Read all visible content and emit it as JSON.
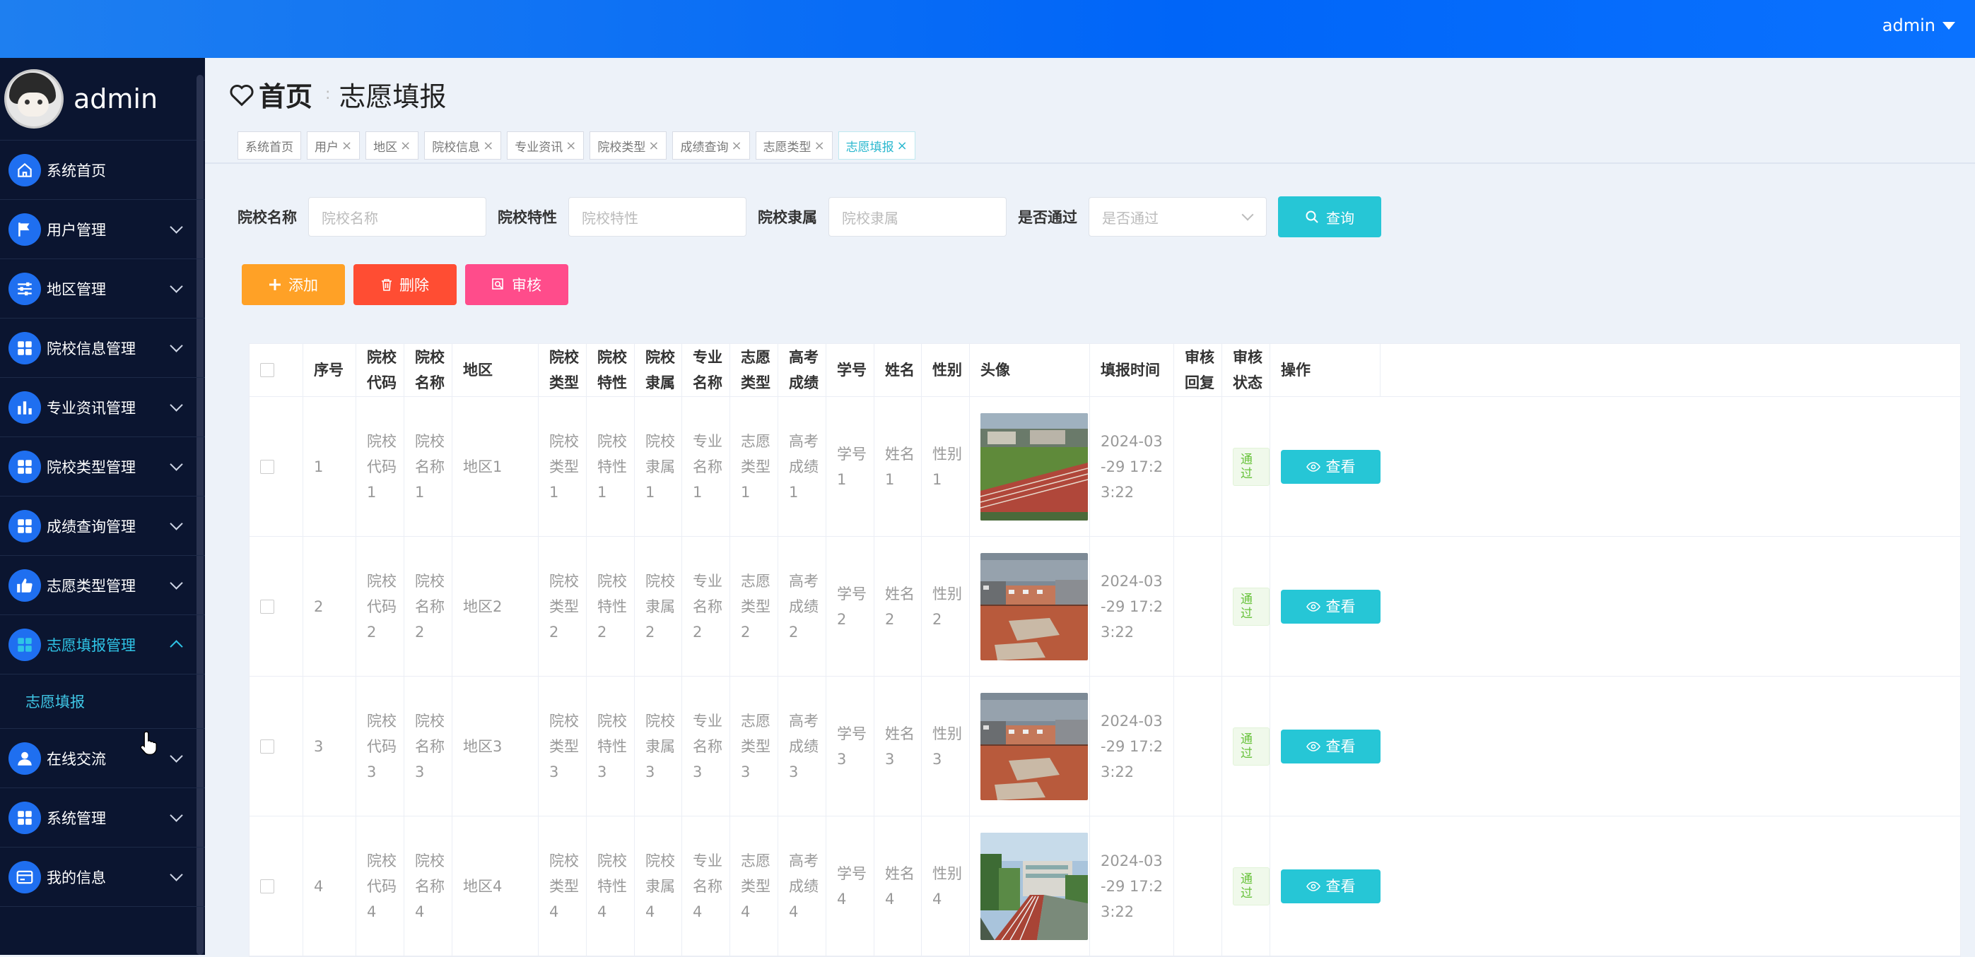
{
  "header": {
    "user": "admin"
  },
  "sidebar": {
    "brand_name": "admin",
    "items": [
      {
        "label": "系统首页",
        "icon": "home-icon",
        "name": "sidebar-item-home",
        "has_arrow": false
      },
      {
        "label": "用户管理",
        "icon": "flag-icon",
        "name": "sidebar-item-users",
        "has_arrow": true
      },
      {
        "label": "地区管理",
        "icon": "sliders-icon",
        "name": "sidebar-item-region",
        "has_arrow": true
      },
      {
        "label": "院校信息管理",
        "icon": "grid-icon",
        "name": "sidebar-item-college-info",
        "has_arrow": true
      },
      {
        "label": "专业资讯管理",
        "icon": "bar-chart-icon",
        "name": "sidebar-item-major-news",
        "has_arrow": true
      },
      {
        "label": "院校类型管理",
        "icon": "grid-icon",
        "name": "sidebar-item-college-type",
        "has_arrow": true
      },
      {
        "label": "成绩查询管理",
        "icon": "grid-icon",
        "name": "sidebar-item-score",
        "has_arrow": true
      },
      {
        "label": "志愿类型管理",
        "icon": "thumbs-up-icon",
        "name": "sidebar-item-wish-type",
        "has_arrow": true
      },
      {
        "label": "志愿填报管理",
        "icon": "grid-icon",
        "name": "sidebar-item-wish-apply",
        "has_arrow": true,
        "active": true
      },
      {
        "label": "志愿填报",
        "sub": true,
        "name": "sidebar-subitem-wish-apply"
      },
      {
        "label": "在线交流",
        "icon": "person-icon",
        "name": "sidebar-item-chat",
        "has_arrow": true
      },
      {
        "label": "系统管理",
        "icon": "grid-icon",
        "name": "sidebar-item-system",
        "has_arrow": true
      },
      {
        "label": "我的信息",
        "icon": "card-icon",
        "name": "sidebar-item-my-info",
        "has_arrow": true
      }
    ]
  },
  "breadcrumb": {
    "home": "首页",
    "current": "志愿填报"
  },
  "tags": [
    {
      "label": "系统首页",
      "closable": false
    },
    {
      "label": "用户",
      "closable": true
    },
    {
      "label": "地区",
      "closable": true
    },
    {
      "label": "院校信息",
      "closable": true
    },
    {
      "label": "专业资讯",
      "closable": true
    },
    {
      "label": "院校类型",
      "closable": true
    },
    {
      "label": "成绩查询",
      "closable": true
    },
    {
      "label": "志愿类型",
      "closable": true
    },
    {
      "label": "志愿填报",
      "closable": true,
      "active": true
    }
  ],
  "search": {
    "fields": [
      {
        "label": "院校名称",
        "placeholder": "院校名称",
        "type": "input"
      },
      {
        "label": "院校特性",
        "placeholder": "院校特性",
        "type": "input"
      },
      {
        "label": "院校隶属",
        "placeholder": "院校隶属",
        "type": "input"
      },
      {
        "label": "是否通过",
        "placeholder": "是否通过",
        "type": "select"
      }
    ],
    "query_label": "查询"
  },
  "actions": {
    "add": "添加",
    "delete": "删除",
    "audit": "审核"
  },
  "colors": {
    "primary": "#26c6d6",
    "add": "#ffa126",
    "delete": "#ff4d33",
    "audit": "#ff4c8b",
    "topbar": "#0065f8",
    "sidebar": "#0b1530"
  },
  "table": {
    "columns": [
      "",
      "序号",
      "院校代码",
      "院校名称",
      "地区",
      "院校类型",
      "院校特性",
      "院校隶属",
      "专业名称",
      "志愿类型",
      "高考成绩",
      "学号",
      "姓名",
      "性别",
      "头像",
      "填报时间",
      "审核回复",
      "审核状态",
      "操作"
    ],
    "rows": [
      {
        "index": "1",
        "code": "院校代码1",
        "name": "院校名称1",
        "region": "地区1",
        "type": "院校类型1",
        "feature": "院校特性1",
        "belong": "院校隶属1",
        "major": "专业名称1",
        "wish_type": "志愿类型1",
        "score": "高考成绩1",
        "student_no": "学号1",
        "student_name": "姓名1",
        "gender": "性别1",
        "photo": "stadium",
        "time": "2024-03-29 17:23:22",
        "reply": "",
        "status": "通过",
        "op": "查看"
      },
      {
        "index": "2",
        "code": "院校代码2",
        "name": "院校名称2",
        "region": "地区2",
        "type": "院校类型2",
        "feature": "院校特性2",
        "belong": "院校隶属2",
        "major": "专业名称2",
        "wish_type": "志愿类型2",
        "score": "高考成绩2",
        "student_no": "学号2",
        "student_name": "姓名2",
        "gender": "性别2",
        "photo": "plaza",
        "time": "2024-03-29 17:23:22",
        "reply": "",
        "status": "通过",
        "op": "查看"
      },
      {
        "index": "3",
        "code": "院校代码3",
        "name": "院校名称3",
        "region": "地区3",
        "type": "院校类型3",
        "feature": "院校特性3",
        "belong": "院校隶属3",
        "major": "专业名称3",
        "wish_type": "志愿类型3",
        "score": "高考成绩3",
        "student_no": "学号3",
        "student_name": "姓名3",
        "gender": "性别3",
        "photo": "plaza",
        "time": "2024-03-29 17:23:22",
        "reply": "",
        "status": "通过",
        "op": "查看"
      },
      {
        "index": "4",
        "code": "院校代码4",
        "name": "院校名称4",
        "region": "地区4",
        "type": "院校类型4",
        "feature": "院校特性4",
        "belong": "院校隶属4",
        "major": "专业名称4",
        "wish_type": "志愿类型4",
        "score": "高考成绩4",
        "student_no": "学号4",
        "student_name": "姓名4",
        "gender": "性别4",
        "photo": "track",
        "time": "2024-03-29 17:23:22",
        "reply": "",
        "status": "通过",
        "op": "查看"
      }
    ]
  }
}
